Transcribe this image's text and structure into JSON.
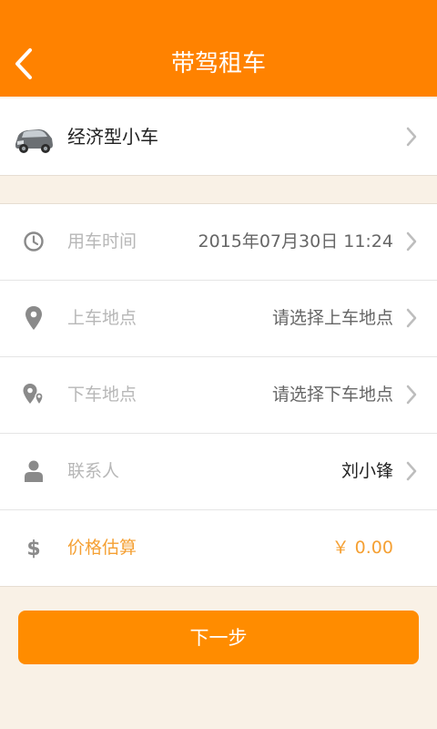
{
  "header": {
    "title": "带驾租车",
    "back_icon": "chevron-left-icon"
  },
  "car": {
    "label": "经济型小车",
    "image": "car-icon"
  },
  "form": {
    "time": {
      "label": "用车时间",
      "value": "2015年07月30日 11:24",
      "icon": "clock-icon"
    },
    "pickup": {
      "label": "上车地点",
      "value": "请选择上车地点",
      "icon": "map-pin-icon"
    },
    "dropoff": {
      "label": "下车地点",
      "value": "请选择下车地点",
      "icon": "map-pin-multi-icon"
    },
    "contact": {
      "label": "联系人",
      "value": "刘小锋",
      "icon": "person-icon"
    },
    "price": {
      "label": "价格估算",
      "value": "￥ 0.00",
      "icon": "dollar-icon"
    }
  },
  "next_button": {
    "label": "下一步"
  },
  "colors": {
    "accent": "#ff8200",
    "button": "#ff8c00",
    "price_text": "#f5a033",
    "background": "#f9f1e6"
  }
}
